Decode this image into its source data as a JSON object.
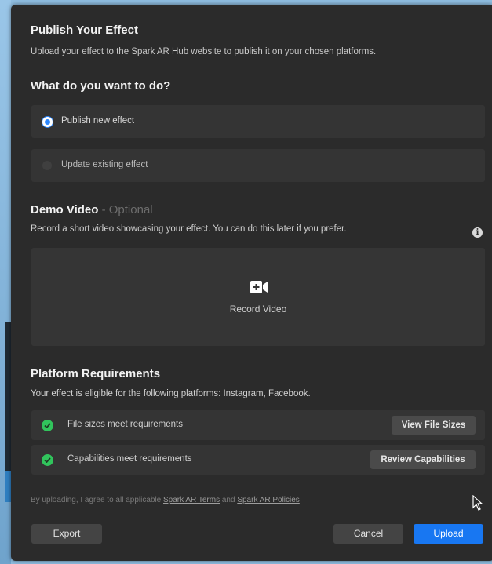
{
  "dialog": {
    "title": "Publish Your Effect",
    "subtitle": "Upload your effect to the Spark AR Hub website to publish it on your chosen platforms."
  },
  "action": {
    "heading": "What do you want to do?",
    "options": [
      {
        "label": "Publish new effect",
        "selected": true
      },
      {
        "label": "Update existing effect",
        "selected": false
      }
    ]
  },
  "demo": {
    "heading": "Demo Video",
    "optional": "- Optional",
    "description": "Record a short video showcasing your effect. You can do this later if you prefer.",
    "info_icon": "info-icon",
    "record_icon": "video-camera-plus-icon",
    "record_label": "Record Video"
  },
  "platform": {
    "heading": "Platform Requirements",
    "description": "Your effect is eligible for the following platforms: Instagram, Facebook.",
    "rows": [
      {
        "label": "File sizes meet requirements",
        "button": "View File Sizes",
        "status": "pass"
      },
      {
        "label": "Capabilities meet requirements",
        "button": "Review Capabilities",
        "status": "pass"
      }
    ]
  },
  "legal": {
    "prefix": "By uploading, I agree to all applicable",
    "terms_link": "Spark AR Terms",
    "and": "and",
    "policies_link": "Spark AR Policies"
  },
  "footer": {
    "export_label": "Export",
    "cancel_label": "Cancel",
    "upload_label": "Upload"
  },
  "colors": {
    "background": "#2b2b2b",
    "accent": "#1877f2",
    "check": "#31c45c"
  }
}
